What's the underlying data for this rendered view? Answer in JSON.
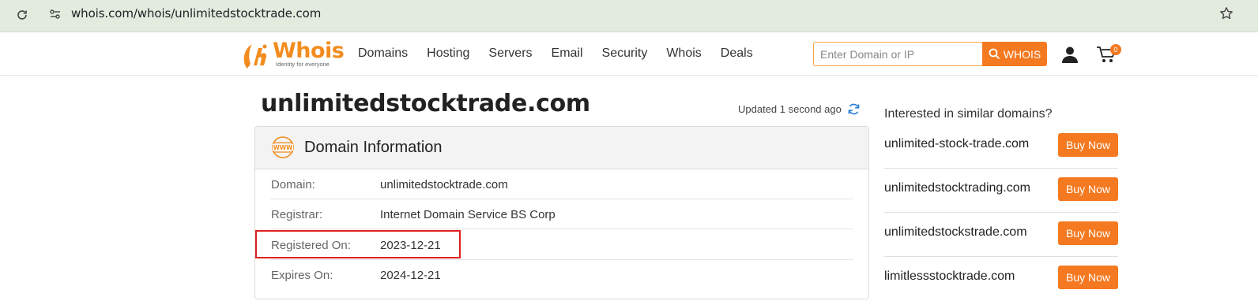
{
  "browser": {
    "url": "whois.com/whois/unlimitedstocktrade.com"
  },
  "header": {
    "logo_word": "Whois",
    "logo_tagline": "Identity for everyone",
    "nav": [
      "Domains",
      "Hosting",
      "Servers",
      "Email",
      "Security",
      "Whois",
      "Deals"
    ],
    "search_placeholder": "Enter Domain or IP",
    "search_button": "WHOIS",
    "cart_count": "0"
  },
  "main": {
    "title": "unlimitedstocktrade.com",
    "updated": "Updated 1 second ago",
    "card_title": "Domain Information",
    "rows": [
      {
        "label": "Domain:",
        "value": "unlimitedstocktrade.com"
      },
      {
        "label": "Registrar:",
        "value": "Internet Domain Service BS Corp"
      },
      {
        "label": "Registered On:",
        "value": "2023-12-21"
      },
      {
        "label": "Expires On:",
        "value": "2024-12-21"
      }
    ]
  },
  "sidebar": {
    "title": "Interested in similar domains?",
    "suggestions": [
      {
        "domain": "unlimited-stock-trade.com",
        "button": "Buy Now"
      },
      {
        "domain": "unlimitedstocktrading.com",
        "button": "Buy Now"
      },
      {
        "domain": "unlimitedstockstrade.com",
        "button": "Buy Now"
      },
      {
        "domain": "limitlessstocktrade.com",
        "button": "Buy Now"
      }
    ]
  },
  "colors": {
    "brand_orange": "#f47920",
    "highlight_red": "#e02020",
    "browser_bar": "#e3ebdf"
  }
}
